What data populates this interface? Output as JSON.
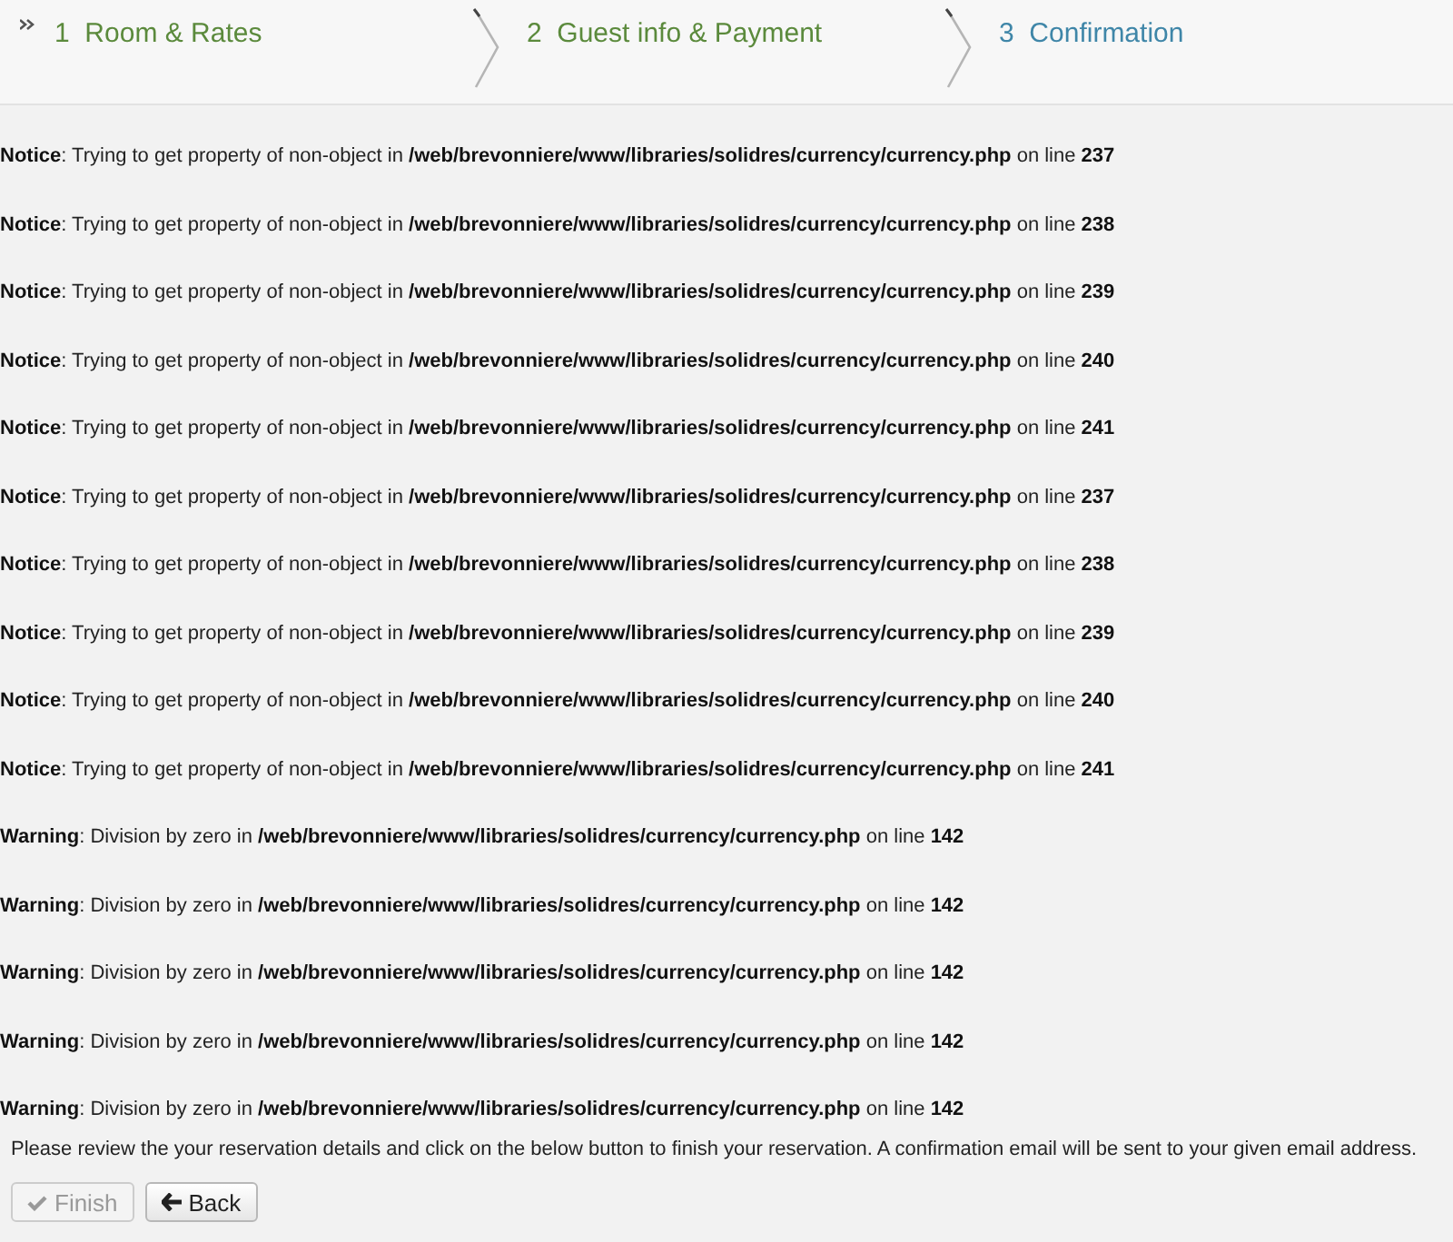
{
  "steps": [
    {
      "number": "1",
      "label": "Room & Rates",
      "selected": false
    },
    {
      "number": "2",
      "label": "Guest info & Payment",
      "selected": false
    },
    {
      "number": "3",
      "label": "Confirmation",
      "selected": true
    }
  ],
  "messages": [
    {
      "text": "**Notice**: Trying to get property of non-object in **/web/brevonniere/www/libraries/solidres/currency/currency.php** on line **237**"
    },
    {
      "text": "**Notice**: Trying to get property of non-object in **/web/brevonniere/www/libraries/solidres/currency/currency.php** on line **238**"
    },
    {
      "text": "**Notice**: Trying to get property of non-object in **/web/brevonniere/www/libraries/solidres/currency/currency.php** on line **239**"
    },
    {
      "text": "**Notice**: Trying to get property of non-object in **/web/brevonniere/www/libraries/solidres/currency/currency.php** on line **240**"
    },
    {
      "text": "**Notice**: Trying to get property of non-object in **/web/brevonniere/www/libraries/solidres/currency/currency.php** on line **241**"
    },
    {
      "text": "**Notice**: Trying to get property of non-object in **/web/brevonniere/www/libraries/solidres/currency/currency.php** on line **237**"
    },
    {
      "text": "**Notice**: Trying to get property of non-object in **/web/brevonniere/www/libraries/solidres/currency/currency.php** on line **238**"
    },
    {
      "text": "**Notice**: Trying to get property of non-object in **/web/brevonniere/www/libraries/solidres/currency/currency.php** on line **239**"
    },
    {
      "text": "**Notice**: Trying to get property of non-object in **/web/brevonniere/www/libraries/solidres/currency/currency.php** on line **240**"
    },
    {
      "text": "**Notice**: Trying to get property of non-object in **/web/brevonniere/www/libraries/solidres/currency/currency.php** on line **241**"
    },
    {
      "text": "**Warning**: Division by zero in **/web/brevonniere/www/libraries/solidres/currency/currency.php** on line **142**"
    },
    {
      "text": "**Warning**: Division by zero in **/web/brevonniere/www/libraries/solidres/currency/currency.php** on line **142**"
    },
    {
      "text": "**Warning**: Division by zero in **/web/brevonniere/www/libraries/solidres/currency/currency.php** on line **142**"
    },
    {
      "text": "**Warning**: Division by zero in **/web/brevonniere/www/libraries/solidres/currency/currency.php** on line **142**"
    },
    {
      "text": "**Warning**: Division by zero in **/web/brevonniere/www/libraries/solidres/currency/currency.php** on line **142**"
    }
  ],
  "instructions": "Please review the your reservation details and click on the below button to finish your reservation. A confirmation email will be sent to your given email address.",
  "buttons": [
    {
      "kind": "finish",
      "label": "Finish",
      "disabled": true
    },
    {
      "kind": "back",
      "label": "Back",
      "disabled": false
    }
  ]
}
